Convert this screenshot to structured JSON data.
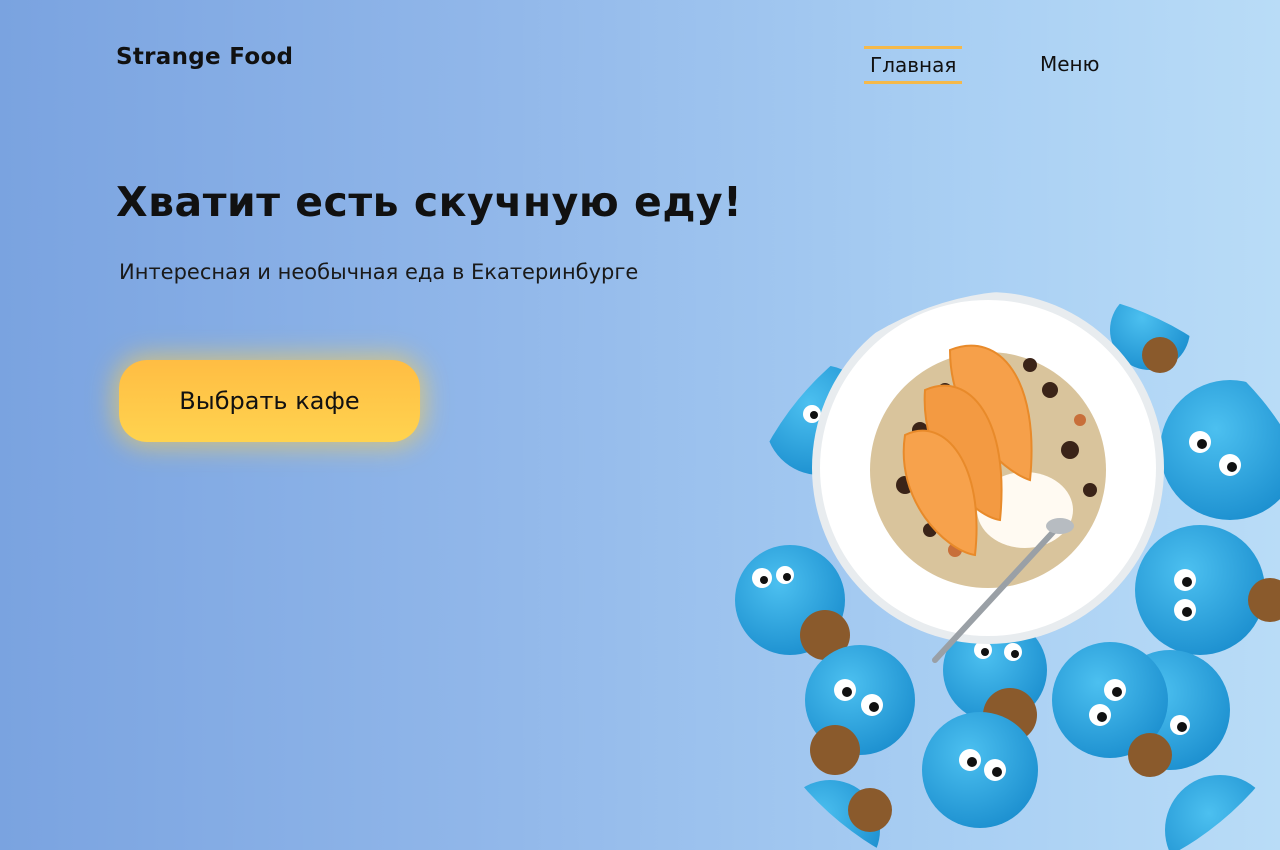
{
  "header": {
    "logo": "Strange Food",
    "nav": [
      {
        "label": "Главная",
        "active": true
      },
      {
        "label": "Меню",
        "active": false
      }
    ]
  },
  "hero": {
    "headline": "Хватит есть скучную еду!",
    "subtitle": "Интересная и необычная еда в Екатеринбурге",
    "cta_label": "Выбрать кафе",
    "image": "bowl-of-granola-with-peaches-and-cookie-monster-macarons"
  },
  "colors": {
    "accent": "#ffc847",
    "nav_underline": "#f5b94a",
    "bg_left": "#7aa3e0",
    "bg_right": "#b9dcf7",
    "macaron": "#2fa7e0"
  }
}
